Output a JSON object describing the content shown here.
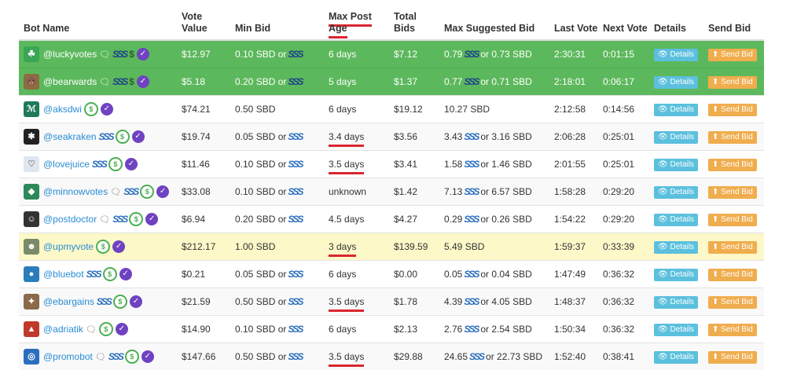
{
  "headers": {
    "bot_name": "Bot Name",
    "vote_value": "Vote Value",
    "min_bid": "Min Bid",
    "max_post_age": "Max Post Age",
    "total_bids": "Total Bids",
    "max_suggested_bid": "Max Suggested Bid",
    "last_vote": "Last Vote",
    "next_vote": "Next Vote",
    "details": "Details",
    "send_bid": "Send Bid"
  },
  "buttons": {
    "details_label": "Details",
    "send_bid_label": "Send Bid"
  },
  "colors": {
    "green_row": "#5cb85c",
    "highlight_row": "#fcf8c8",
    "details": "#5bc0de",
    "send_bid": "#f0ad4e",
    "underline": "#d9262f",
    "verified": "#6f42c1"
  },
  "icons": [
    "comment-icon",
    "steem-icon",
    "dollar-icon",
    "verified-check-icon",
    "eye-icon",
    "upload-icon"
  ],
  "rows": [
    {
      "name": "@luckyvotes",
      "vote_value": "$12.97",
      "min_bid": "0.10 SBD or",
      "max_age": "6 days",
      "total_bids": "$7.12",
      "suggested_a": "0.79",
      "suggested_b": "or 0.73 SBD",
      "last_vote": "2:30:31",
      "next_vote": "0:01:15"
    },
    {
      "name": "@bearwards",
      "vote_value": "$5.18",
      "min_bid": "0.20 SBD or",
      "max_age": "5 days",
      "total_bids": "$1.37",
      "suggested_a": "0.77",
      "suggested_b": "or 0.71 SBD",
      "last_vote": "2:18:01",
      "next_vote": "0:06:17"
    },
    {
      "name": "@aksdwi",
      "vote_value": "$74.21",
      "min_bid": "0.50 SBD",
      "max_age": "6 days",
      "total_bids": "$19.12",
      "suggested_a": "10.27 SBD",
      "suggested_b": "",
      "last_vote": "2:12:58",
      "next_vote": "0:14:56"
    },
    {
      "name": "@seakraken",
      "vote_value": "$19.74",
      "min_bid": "0.05 SBD or",
      "max_age": "3.4 days",
      "total_bids": "$3.56",
      "suggested_a": "3.43",
      "suggested_b": "or 3.16 SBD",
      "last_vote": "2:06:28",
      "next_vote": "0:25:01"
    },
    {
      "name": "@lovejuice",
      "vote_value": "$11.46",
      "min_bid": "0.10 SBD or",
      "max_age": "3.5 days",
      "total_bids": "$3.41",
      "suggested_a": "1.58",
      "suggested_b": "or 1.46 SBD",
      "last_vote": "2:01:55",
      "next_vote": "0:25:01"
    },
    {
      "name": "@minnowvotes",
      "vote_value": "$33.08",
      "min_bid": "0.10 SBD or",
      "max_age": "unknown",
      "total_bids": "$1.42",
      "suggested_a": "7.13",
      "suggested_b": "or 6.57 SBD",
      "last_vote": "1:58:28",
      "next_vote": "0:29:20"
    },
    {
      "name": "@postdoctor",
      "vote_value": "$6.94",
      "min_bid": "0.20 SBD or",
      "max_age": "4.5 days",
      "total_bids": "$4.27",
      "suggested_a": "0.29",
      "suggested_b": "or 0.26 SBD",
      "last_vote": "1:54:22",
      "next_vote": "0:29:20"
    },
    {
      "name": "@upmyvote",
      "vote_value": "$212.17",
      "min_bid": "1.00 SBD",
      "max_age": "3 days",
      "total_bids": "$139.59",
      "suggested_a": "5.49 SBD",
      "suggested_b": "",
      "last_vote": "1:59:37",
      "next_vote": "0:33:39"
    },
    {
      "name": "@bluebot",
      "vote_value": "$0.21",
      "min_bid": "0.05 SBD or",
      "max_age": "6 days",
      "total_bids": "$0.00",
      "suggested_a": "0.05",
      "suggested_b": "or 0.04 SBD",
      "last_vote": "1:47:49",
      "next_vote": "0:36:32"
    },
    {
      "name": "@ebargains",
      "vote_value": "$21.59",
      "min_bid": "0.50 SBD or",
      "max_age": "3.5 days",
      "total_bids": "$1.78",
      "suggested_a": "4.39",
      "suggested_b": "or 4.05 SBD",
      "last_vote": "1:48:37",
      "next_vote": "0:36:32"
    },
    {
      "name": "@adriatik",
      "vote_value": "$14.90",
      "min_bid": "0.10 SBD or",
      "max_age": "6 days",
      "total_bids": "$2.13",
      "suggested_a": "2.76",
      "suggested_b": "or 2.54 SBD",
      "last_vote": "1:50:34",
      "next_vote": "0:36:32"
    },
    {
      "name": "@promobot",
      "vote_value": "$147.66",
      "min_bid": "0.50 SBD or",
      "max_age": "3.5 days",
      "total_bids": "$29.88",
      "suggested_a": "24.65",
      "suggested_b": "or 22.73 SBD",
      "last_vote": "1:52:40",
      "next_vote": "0:38:41"
    }
  ]
}
